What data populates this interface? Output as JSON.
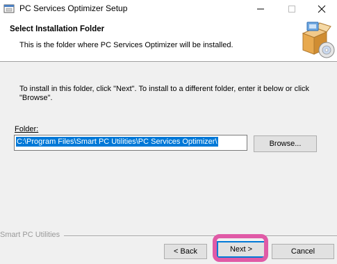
{
  "window": {
    "title": "PC Services Optimizer Setup",
    "icon": "installer-icon",
    "controls": [
      "minimize-icon",
      "maximize-icon",
      "close-icon"
    ]
  },
  "header": {
    "title": "Select Installation Folder",
    "subtitle": "This is the folder where PC Services Optimizer will be installed.",
    "graphic": "install-box-cd-icon"
  },
  "body": {
    "instructions": "To install in this folder, click \"Next\". To install to a different folder, enter it below or click \"Browse\".",
    "folder_label": "Folder:",
    "folder_value": "C:\\Program Files\\Smart PC Utilities\\PC Services Optimizer\\",
    "browse_label": "Browse..."
  },
  "footer": {
    "brand": "Smart PC Utilities",
    "back_label": "< Back",
    "next_label": "Next >",
    "cancel_label": "Cancel"
  },
  "colors": {
    "selection": "#0078d7",
    "highlight": "#e05aa6",
    "dialog_bg": "#f0f0f0"
  }
}
